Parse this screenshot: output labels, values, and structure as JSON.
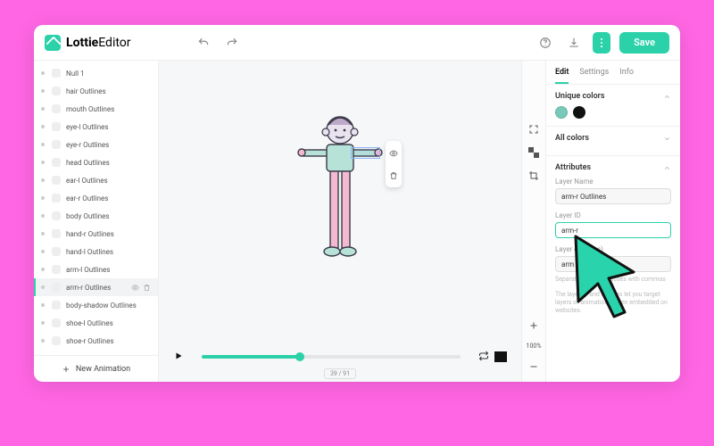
{
  "brand": {
    "part1": "Lottie",
    "part2": "Editor"
  },
  "topbar": {
    "save_label": "Save"
  },
  "layers": {
    "items": [
      {
        "label": "Null 1"
      },
      {
        "label": "hair Outlines"
      },
      {
        "label": "mouth Outlines"
      },
      {
        "label": "eye-l Outlines"
      },
      {
        "label": "eye-r Outlines"
      },
      {
        "label": "head Outlines"
      },
      {
        "label": "ear-l Outlines"
      },
      {
        "label": "ear-r Outlines"
      },
      {
        "label": "body Outlines"
      },
      {
        "label": "hand-r Outlines"
      },
      {
        "label": "hand-l Outlines"
      },
      {
        "label": "arm-l Outlines"
      },
      {
        "label": "arm-r Outlines",
        "selected": true
      },
      {
        "label": "body-shadow Outlines"
      },
      {
        "label": "shoe-l Outlines"
      },
      {
        "label": "shoe-r Outlines"
      }
    ],
    "new_animation_label": "New Animation"
  },
  "timeline": {
    "frame_display": "39 / 91"
  },
  "vtoolbar": {
    "zoom_label": "100%"
  },
  "inspector": {
    "tabs": {
      "edit": "Edit",
      "settings": "Settings",
      "info": "Info"
    },
    "unique_colors_title": "Unique colors",
    "unique_colors": [
      "#78c9b7",
      "#111111"
    ],
    "all_colors_title": "All colors",
    "attributes_title": "Attributes",
    "layer_name_label": "Layer Name",
    "layer_name_value": "arm-r Outlines",
    "layer_id_label": "Layer ID",
    "layer_id_value": "arm-r",
    "layer_classes_label": "Layer class(es)",
    "layer_classes_value": "arm",
    "classes_hint": "Separate multiple classes with commas",
    "id_hint": "The layer ID and classes let you target layers of animations when embedded on websites."
  }
}
